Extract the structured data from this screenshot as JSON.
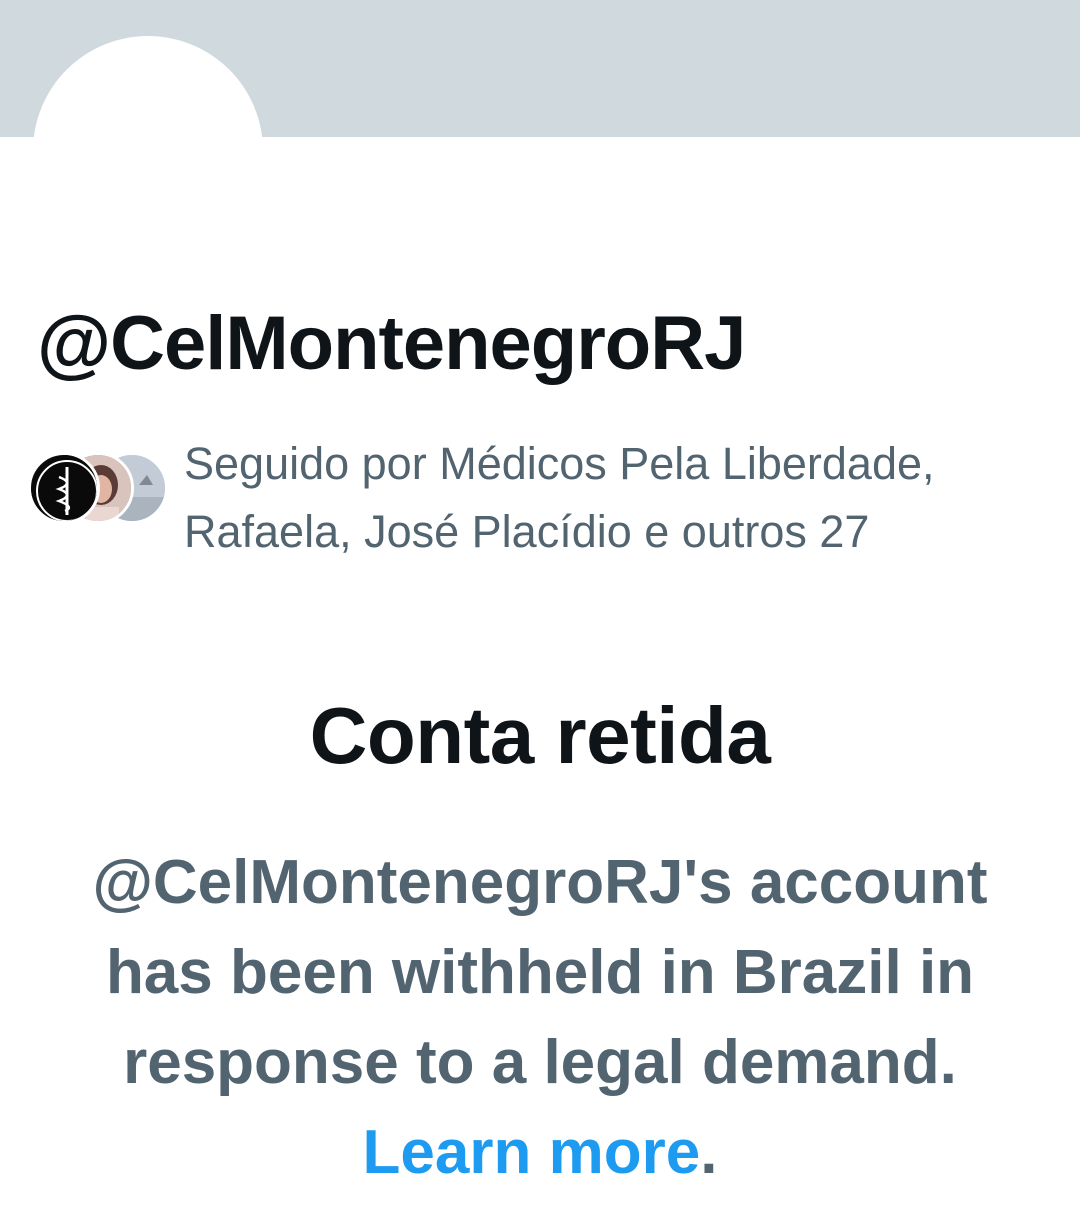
{
  "profile": {
    "handle": "@CelMontenegroRJ"
  },
  "followers": {
    "prefix": "Seguido por ",
    "names": "Médicos Pela Liberdade, Rafaela, José Placídio",
    "suffix": " e outros 27"
  },
  "withheld": {
    "title": "Conta retida",
    "message": "@CelMontenegroRJ's account has been withheld in Brazil in response to a legal demand. ",
    "link_label": "Learn more",
    "trailing": "."
  },
  "colors": {
    "banner": "#cfd9de",
    "primary_text": "#0f1419",
    "secondary_text": "#536471",
    "link": "#1d9bf0"
  }
}
